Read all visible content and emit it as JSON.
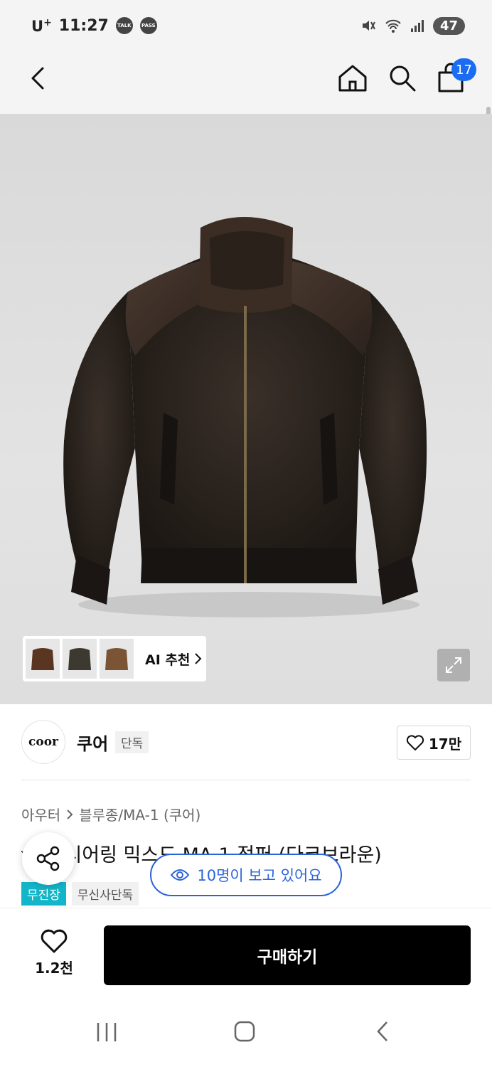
{
  "status_bar": {
    "carrier": "U",
    "carrier_plus": "+",
    "time": "11:27",
    "talk_badge": "TALK",
    "pass_badge": "PASS",
    "battery": "47"
  },
  "header": {
    "cart_count": "17"
  },
  "image_overlay": {
    "ai_recommend_label": "AI 추천"
  },
  "brand": {
    "logo_text": "coor",
    "name": "쿠어",
    "exclusive_tag": "단독",
    "like_count": "17만"
  },
  "product": {
    "breadcrumb": [
      "아우터",
      "블루종/MA-1 (쿠어)"
    ],
    "title": "〰렉 시어링 믹스드 MA-1 점퍼 (다크브라운)",
    "tags": [
      "무진장",
      "무신사단독"
    ],
    "viewers_text": "10명이 보고 있어요"
  },
  "bottom_bar": {
    "wish_count": "1.2천",
    "buy_label": "구매하기"
  },
  "colors": {
    "accent_blue": "#1b6cf2",
    "viewer_blue": "#2b64d9",
    "standard_teal": "#13b6c9",
    "buy_black": "#000000"
  },
  "icons": [
    "back-icon",
    "home-icon",
    "search-icon",
    "cart-icon",
    "expand-icon",
    "chevron-right-icon",
    "heart-icon",
    "share-icon",
    "eye-icon"
  ]
}
